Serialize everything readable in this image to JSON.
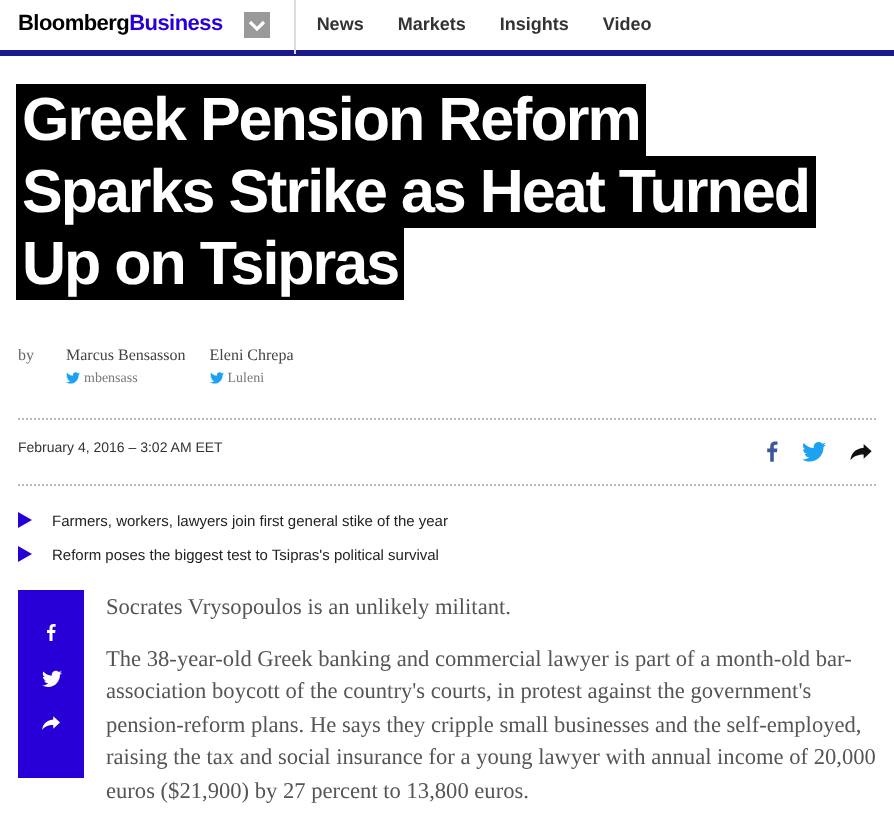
{
  "header": {
    "brand_main": "Bloomberg",
    "brand_accent": "Business",
    "nav": [
      {
        "label": "News"
      },
      {
        "label": "Markets"
      },
      {
        "label": "Insights"
      },
      {
        "label": "Video"
      }
    ]
  },
  "headline": [
    "Greek Pension Reform",
    "Sparks Strike as Heat Turned",
    "Up on Tsipras"
  ],
  "byline": {
    "prefix": "by",
    "authors": [
      {
        "name": "Marcus Bensasson",
        "handle": "mbensass"
      },
      {
        "name": "Eleni Chrepa",
        "handle": "Luleni"
      }
    ]
  },
  "date": "February 4, 2016 – 3:02 AM EET",
  "highlights": [
    "Farmers, workers, lawyers join first general stike of the year",
    "Reform poses the biggest test to Tsipras's political survival"
  ],
  "paragraphs": [
    "Socrates Vrysopoulos is an unlikely militant.",
    "The 38-year-old Greek banking and commercial lawyer is part of a month-old bar-association boycott of the country's courts, in protest against the government's pension-reform plans. He says they cripple small businesses and the self-employed, raising the tax and social insurance for a young lawyer with annual income of 20,000 euros ($21,900) by 27 percent to 13,800 euros."
  ]
}
